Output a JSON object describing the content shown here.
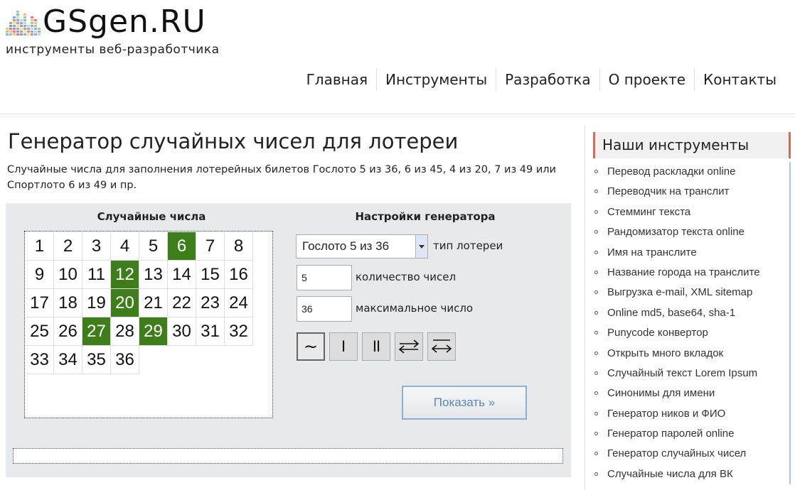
{
  "header": {
    "logo_text": "GSgen.RU",
    "tagline": "инструменты веб-разработчика",
    "nav": [
      "Главная",
      "Инструменты",
      "Разработка",
      "О проекте",
      "Контакты"
    ]
  },
  "main": {
    "title": "Генератор случайных чисел для лотереи",
    "intro_line1": "Случайные числа для заполнения лотерейных билетов Гослото 5 из 36, 6 из 45, 4 из 20, 7 из 49 или",
    "intro_line2": "Спортлото 6 из 49 и пр.",
    "numbers_heading": "Случайные числа",
    "settings_heading": "Настройки генератора",
    "numbers": [
      "1",
      "2",
      "3",
      "4",
      "5",
      "6",
      "7",
      "8",
      "9",
      "10",
      "11",
      "12",
      "13",
      "14",
      "15",
      "16",
      "17",
      "18",
      "19",
      "20",
      "21",
      "22",
      "23",
      "24",
      "25",
      "26",
      "27",
      "28",
      "29",
      "30",
      "31",
      "32",
      "33",
      "34",
      "35",
      "36"
    ],
    "selected_numbers": [
      6,
      12,
      20,
      27,
      29
    ],
    "selected_color": "#3e7e1a",
    "lottery_type": {
      "value": "Гослото 5 из 36",
      "label": "тип лотереи"
    },
    "count": {
      "value": "5",
      "label": "количество чисел"
    },
    "max_number": {
      "value": "36",
      "label": "максимальное число"
    },
    "sort_buttons": [
      {
        "glyph": "~",
        "icon": "unsorted-icon",
        "active": true
      },
      {
        "glyph": "I",
        "icon": "single-column-icon",
        "active": false
      },
      {
        "glyph": "II",
        "icon": "double-column-icon",
        "active": false
      },
      {
        "glyph": "",
        "icon": "swap-arrows-icon",
        "active": false
      },
      {
        "glyph": "",
        "icon": "swap-arrows-bar-icon",
        "active": false
      }
    ],
    "show_button": "Показать »"
  },
  "sidebar": {
    "title": "Наши инструменты",
    "accent_color": "#d46a5a",
    "items": [
      "Перевод раскладки online",
      "Переводчик на транслит",
      "Стемминг текста",
      "Рандомизатор текста online",
      "Имя на транслите",
      "Название города на транслите",
      "Выгрузка e-mail, XML sitemap",
      "Online md5, base64, sha-1",
      "Punycode конвертор",
      "Открыть много вкладок",
      "Случайный текст Lorem Ipsum",
      "Синонимы для имени",
      "Генератор ников и ФИО",
      "Генератор паролей online",
      "Генератор случайных чисел",
      "Случайные числа для ВК"
    ]
  }
}
